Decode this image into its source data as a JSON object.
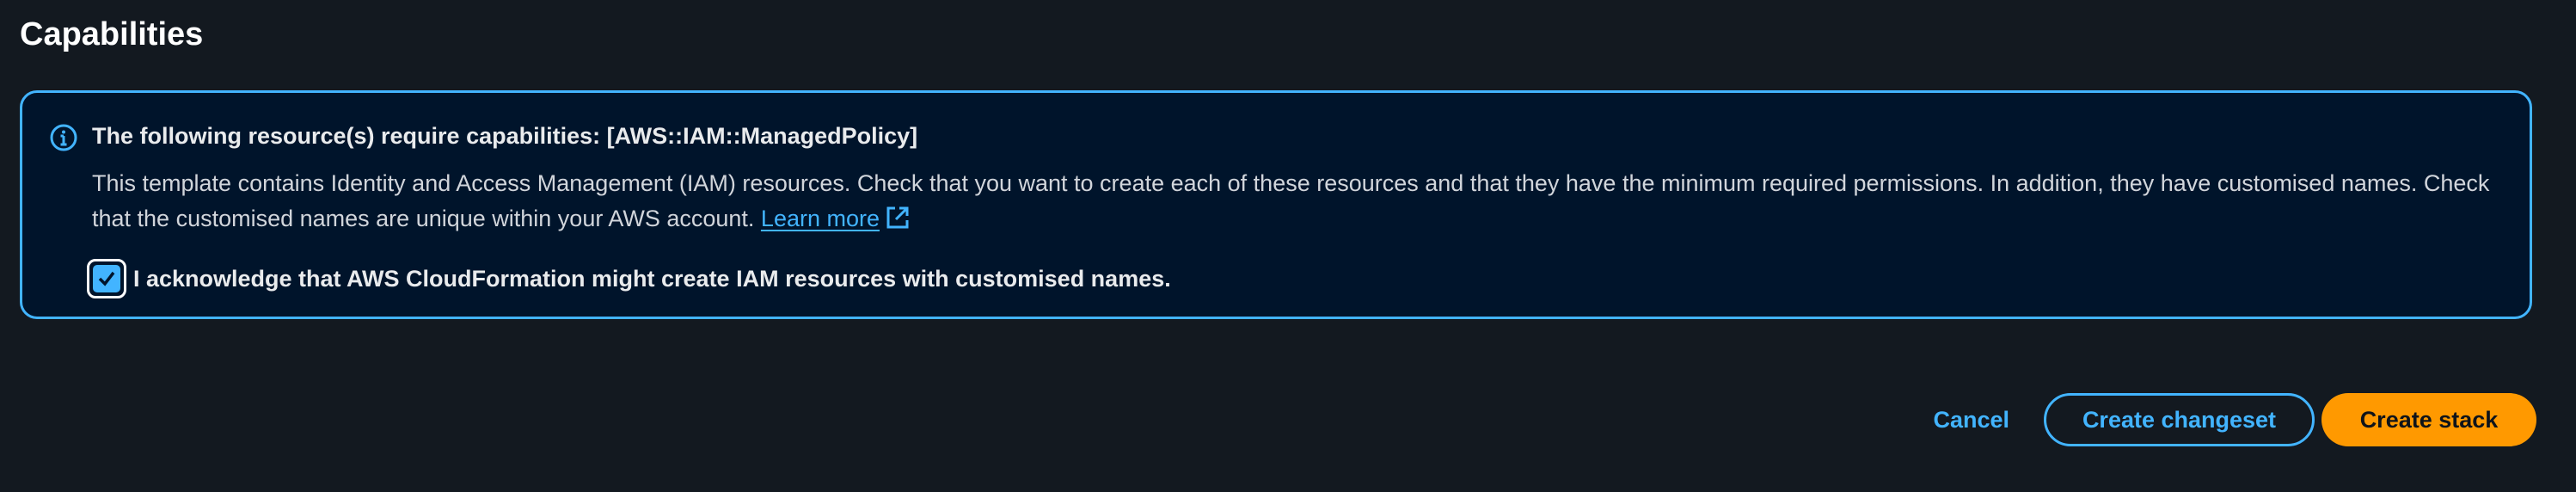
{
  "section": {
    "title": "Capabilities"
  },
  "alert": {
    "icon": "info-icon",
    "heading": "The following resource(s) require capabilities: [AWS::IAM::ManagedPolicy]",
    "body": "This template contains Identity and Access Management (IAM) resources. Check that you want to create each of these resources and that they have the minimum required permissions. In addition, they have customised names. Check that the customised names are unique within your AWS account.",
    "learn_more": "Learn more",
    "learn_more_icon": "external-link-icon",
    "acknowledge_label": "I acknowledge that AWS CloudFormation might create IAM resources with customised names.",
    "acknowledge_checked": true
  },
  "actions": {
    "cancel": "Cancel",
    "create_changeset": "Create changeset",
    "create_stack": "Create stack"
  },
  "colors": {
    "background": "#131920",
    "accent": "#42b4ff",
    "alert_background": "#00142b",
    "primary_button": "#ff9900"
  }
}
